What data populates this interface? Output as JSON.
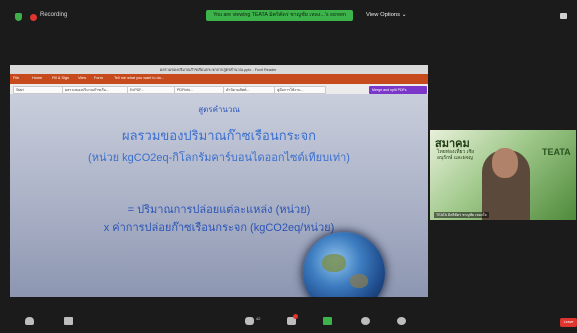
{
  "zoom": {
    "recording_label": "Recording",
    "banner_text": "You are viewing TEATA มิตริตัดร่ ชาญชัย เหลง...'s screen",
    "view_options_label": "View Options ⌄",
    "participants_count": "42",
    "leave_label": "Leave"
  },
  "window": {
    "title": "ผลรวมของปริมาณก๊าซเรือนกระจกจากสูตรคำนวณ.pptx - Foxit Reader",
    "ribbon_items": [
      "File",
      "Home",
      "Fill & Sign",
      "View",
      "Form",
      "Tell me what you want to do..."
    ],
    "tabs": [
      "Start",
      "ผลรวมของปริมาณก๊าซเรือ...",
      "ExPDF...",
      "PDFInfo...",
      "คำนิยามศัพท์...",
      "คู่มือการใช้งาน...",
      "Merge and split PDFs"
    ]
  },
  "slide": {
    "kicker": "สูตรคำนวณ",
    "title": "ผลรวมของปริมาณก๊าซเรือนกระจก",
    "subtitle": "(หน่วย kgCO2eq-กิโลกรัมคาร์บอนไดออกไซด์เทียบเท่า)",
    "eq1": "= ปริมาณการปล่อยแต่ละแหล่ง (หน่วย)",
    "eq2": "x ค่าการปล่อยก๊าซเรือนกระจก (kgCO2eq/หน่วย)"
  },
  "speaker": {
    "banner_title": "สมาคม",
    "banner_sub": "ไทยท่องเที่ยว เชิงอนุรักษ์ และผจญ",
    "logo_text": "TEATA",
    "name": "TEATA มิตริตัดร่ ชาญชัย เหลงใจ"
  }
}
